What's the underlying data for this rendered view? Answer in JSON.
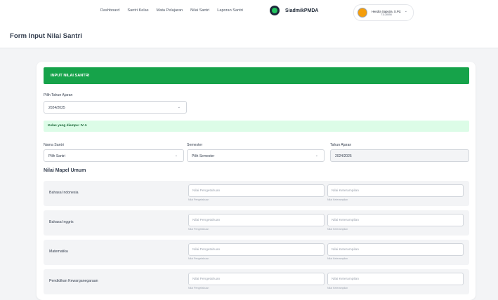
{
  "nav": {
    "items": [
      "Dashboard",
      "Santri Kelas",
      "Mata Pelajaran",
      "Nilai Santri",
      "Laporan Santri"
    ]
  },
  "brand": {
    "name": "SiadmikPMDA"
  },
  "user": {
    "name": "Hendra Saputra, S.Pd.",
    "id": "71128556"
  },
  "page": {
    "title": "Form Input Nilai Santri"
  },
  "form": {
    "card_title": "INPUT NILAI SANTRI",
    "tahun_ajaran_label": "Pilih Tahun Ajaran",
    "tahun_ajaran_value": "2024/2025",
    "alert_text": "Kelas yang diampu: IV A",
    "nama_santri_label": "Nama Santri",
    "nama_santri_value": "Pilih Santri",
    "semester_label": "Semester",
    "semester_value": "Pilih Semester",
    "tahun_label": "Tahun Ajaran",
    "tahun_value": "2024/2025",
    "section_title": "Nilai Mapel Umum",
    "placeholder_pengetahuan": "Nilai Pengetahuan",
    "placeholder_keterampilan": "Nilai Keterampilan",
    "help_pengetahuan": "Nilai Pengetahuan",
    "help_keterampilan": "Nilai Keterampilan",
    "subjects": [
      "Bahasa Indonesia",
      "Bahasa Inggris",
      "Matematika",
      "Pendidikan Kewarganegaraan"
    ]
  },
  "colors": {
    "accent": "#16a34a",
    "alert_bg": "#dcfce7"
  },
  "icons": {
    "dropdown": "chevron-down-icon",
    "brand": "logo-icon",
    "avatar": "avatar-icon"
  }
}
